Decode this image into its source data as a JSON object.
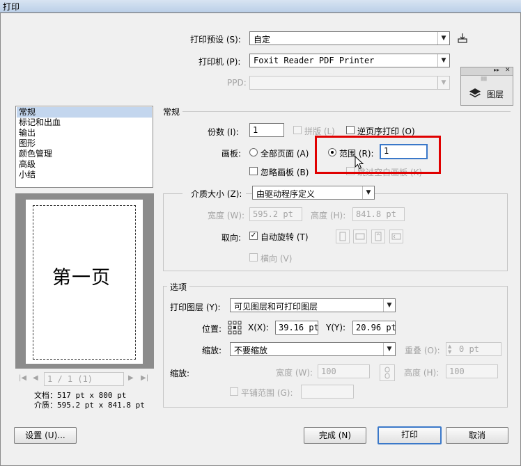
{
  "window": {
    "title": "打印"
  },
  "preset": {
    "label": "打印预设 (S):",
    "value": "自定"
  },
  "printer": {
    "label": "打印机 (P):",
    "value": "Foxit Reader PDF Printer"
  },
  "ppd": {
    "label": "PPD:"
  },
  "layers_panel": {
    "label": "图层",
    "grip": "||||||||",
    "collapse": "▸▸",
    "close": "✕"
  },
  "sidebar": {
    "items": [
      {
        "label": "常规"
      },
      {
        "label": "标记和出血"
      },
      {
        "label": "输出"
      },
      {
        "label": "图形"
      },
      {
        "label": "颜色管理"
      },
      {
        "label": "高级"
      },
      {
        "label": "小结"
      }
    ]
  },
  "preview": {
    "page_text": "第一页",
    "nav": "1 / 1 (1)",
    "doc_info": "文档：517 pt x 800 pt",
    "media_info": "介质：595.2 pt x 841.8 pt"
  },
  "general": {
    "title": "常规",
    "copies_label": "份数 (I):",
    "copies_value": "1",
    "collate_label": "拼版 (L)",
    "reverse_label": "逆页序打印 (O)",
    "artboard_label": "画板:",
    "all_pages_label": "全部页面 (A)",
    "range_label": "范围 (R):",
    "range_value": "1",
    "ignore_artboard_label": "忽略画板 (B)",
    "skip_blank_label": "跳过空白画板 (K)"
  },
  "media": {
    "label": "介质大小 (Z):",
    "value": "由驱动程序定义",
    "width_label": "宽度 (W):",
    "width_value": "595.2 pt",
    "height_label": "高度 (H):",
    "height_value": "841.8 pt",
    "orientation_label": "取向:",
    "auto_rotate_label": "自动旋转 (T)",
    "transverse_label": "横向 (V)"
  },
  "options": {
    "title": "选项",
    "print_layers_label": "打印图层 (Y):",
    "print_layers_value": "可见图层和可打印图层",
    "position_label": "位置:",
    "x_label": "X(X):",
    "x_value": "39.16 pt",
    "y_label": "Y(Y):",
    "y_value": "20.96 pt",
    "scaling_label": "缩放:",
    "scaling_value": "不要缩放",
    "overlap_label": "重叠 (O):",
    "overlap_value": "0 pt",
    "scale_label": "缩放:",
    "scale_width_label": "宽度 (W):",
    "scale_width_value": "100",
    "scale_height_label": "高度 (H):",
    "scale_height_value": "100",
    "tile_label": "平铺范围 (G):"
  },
  "buttons": {
    "setup": "设置 (U)...",
    "done": "完成 (N)",
    "print": "打印",
    "cancel": "取消"
  },
  "colors": {
    "highlight": "#e00000",
    "selection": "#c3d6ee",
    "focus": "#3a78c9"
  }
}
